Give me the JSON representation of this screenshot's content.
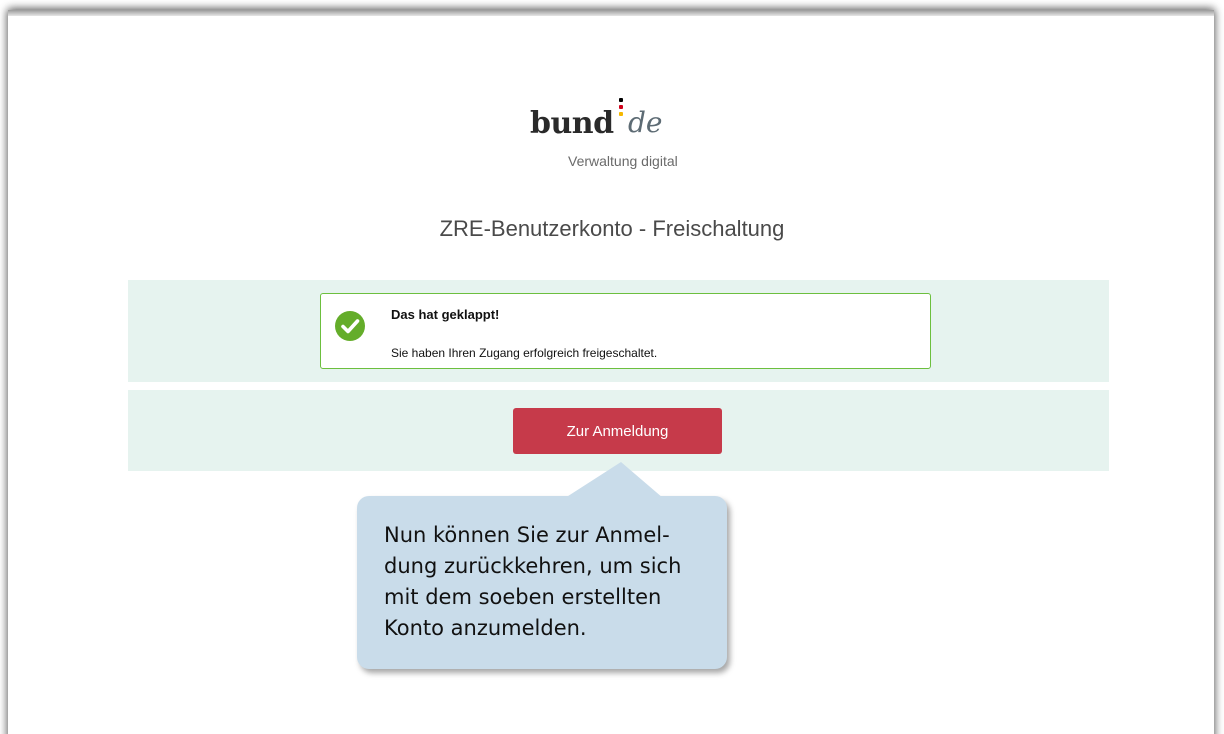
{
  "logo": {
    "word": "bund",
    "suffix": "de",
    "subtitle": "Verwaltung digital",
    "dot_colors": [
      "#000000",
      "#d0021b",
      "#f5b800"
    ]
  },
  "page": {
    "title": "ZRE-Benutzerkonto - Freischaltung"
  },
  "success": {
    "icon": "check-circle-icon",
    "title": "Das hat geklappt!",
    "message": "Sie haben Ihren Zugang erfolgreich freigeschaltet."
  },
  "actions": {
    "login_label": "Zur Anmeldung"
  },
  "callout": {
    "text": "Nun können Sie zur Anmel-\ndung zurückkehren, um sich\nmit dem soeben erstellten\nKonto anzumelden."
  },
  "colors": {
    "panel_bg": "#e6f3ef",
    "success_border": "#6cbf3e",
    "success_icon": "#64ad2a",
    "button_bg": "#c63a4a",
    "callout_bg": "#c9dcea"
  }
}
